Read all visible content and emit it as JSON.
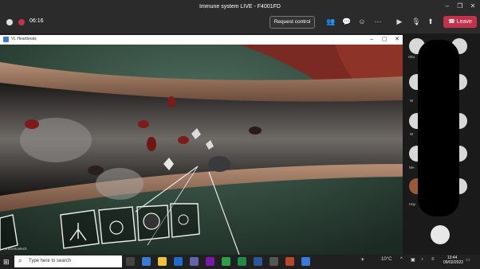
{
  "window": {
    "title": "Immune system LIVE - F4001FD"
  },
  "meeting": {
    "timer": "06:16",
    "request_control_label": "Request control",
    "leave_label": "Leave"
  },
  "shared_window": {
    "title": "VL Heartbeats",
    "watermark": "vrsciencetech"
  },
  "participants": [
    {
      "name": "Oko"
    },
    {
      "name": "W"
    },
    {
      "name": "W"
    },
    {
      "name": "We"
    },
    {
      "name": "Hay"
    }
  ],
  "taskbar": {
    "search_placeholder": "Type here to search",
    "weather": "10°C",
    "time": "13:44",
    "date": "09/02/2022"
  },
  "colors": {
    "leave": "#c4314b",
    "toolbar": "#2b2b2b",
    "vessel_wall": "#9b7a65"
  }
}
